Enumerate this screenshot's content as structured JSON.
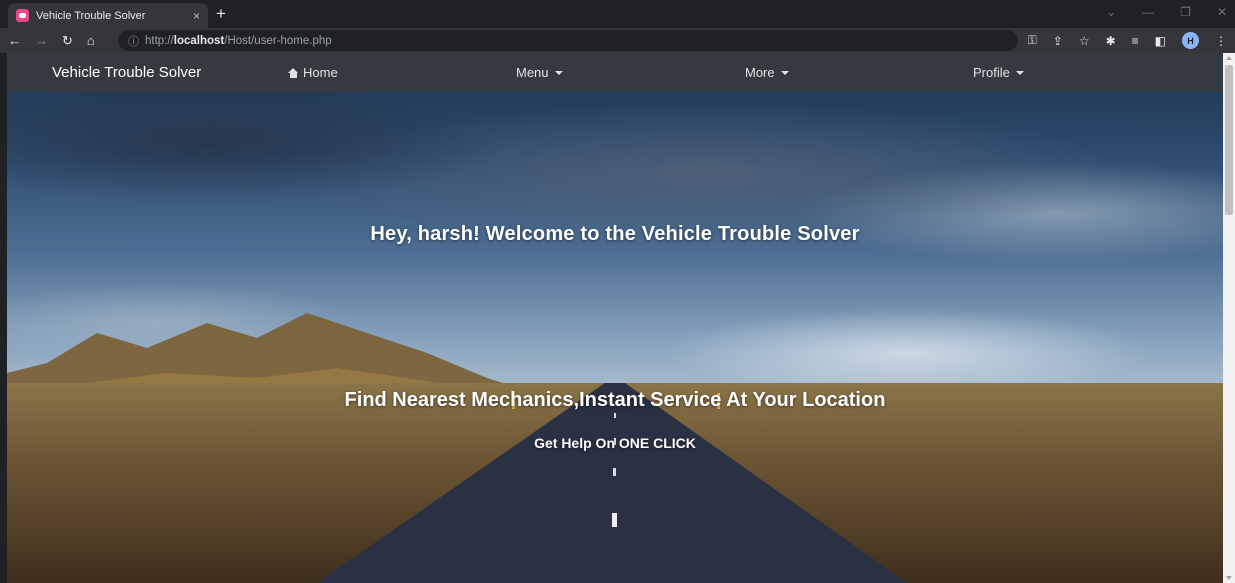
{
  "browser": {
    "tab_title": "Vehicle Trouble Solver",
    "tab_close": "×",
    "new_tab": "+",
    "url_scheme": "http://",
    "url_host": "localhost",
    "url_path": "/Host/user-home.php",
    "profile_initial": "H"
  },
  "navbar": {
    "brand": "Vehicle Trouble Solver",
    "home": "Home",
    "menu": "Menu",
    "more": "More",
    "profile": "Profile"
  },
  "hero": {
    "welcome": "Hey, harsh! Welcome to the Vehicle Trouble Solver",
    "tagline": "Find Nearest Mechanics,Instant Service At Your Location",
    "cta": "Get Help On ONE CLICK"
  }
}
